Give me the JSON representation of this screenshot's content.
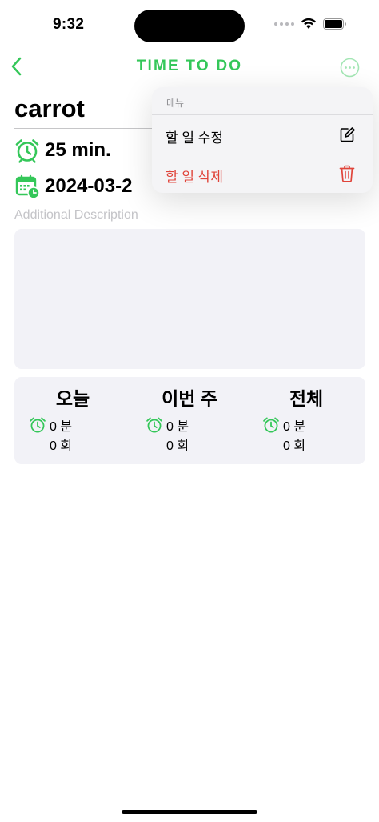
{
  "status_bar": {
    "time": "9:32"
  },
  "nav": {
    "title": "TIME TO DO",
    "accent_color": "#34c759",
    "back_icon": "chevron-left-icon",
    "more_icon": "ellipsis-circle-icon"
  },
  "task": {
    "title": "carrot",
    "duration": "25 min.",
    "date": "2024-03-2",
    "description_placeholder": "Additional Description",
    "duration_icon": "alarm-clock-icon",
    "date_icon": "calendar-clock-icon"
  },
  "stats": [
    {
      "heading": "오늘",
      "minutes": "0 분",
      "count": "0 회"
    },
    {
      "heading": "이번 주",
      "minutes": "0 분",
      "count": "0 회"
    },
    {
      "heading": "전체",
      "minutes": "0 분",
      "count": "0 회"
    }
  ],
  "menu": {
    "header": "메뉴",
    "items": [
      {
        "label": "할 일 수정",
        "icon": "square-pencil-icon",
        "color": "#000000"
      },
      {
        "label": "할 일 삭제",
        "icon": "trash-icon",
        "color": "#e0443a"
      }
    ]
  }
}
